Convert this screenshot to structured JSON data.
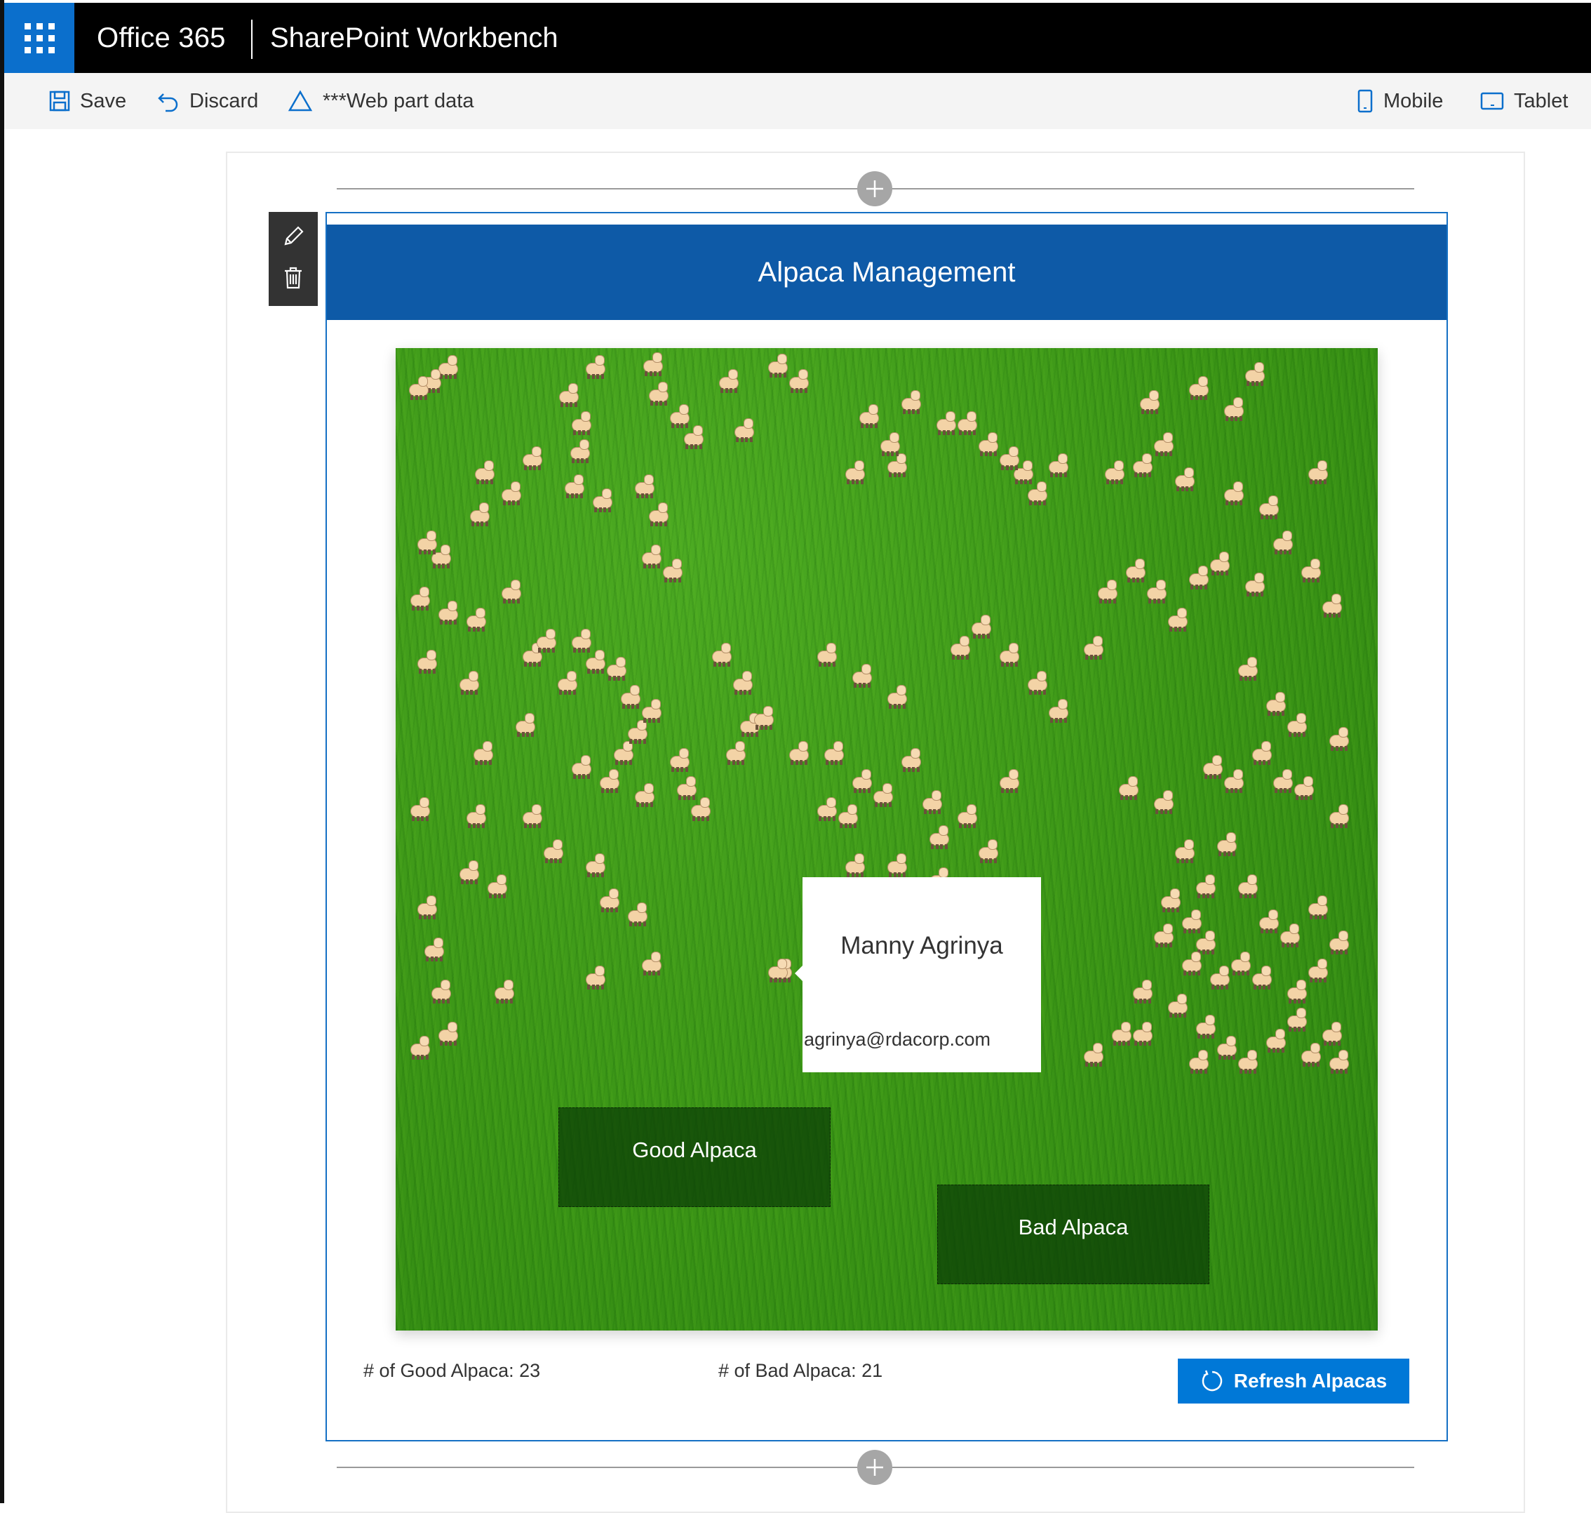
{
  "suite_bar": {
    "brand": "Office 365",
    "app_title": "SharePoint Workbench",
    "accent_color": "#0b6fcc"
  },
  "command_bar": {
    "save_label": "Save",
    "discard_label": "Discard",
    "webpart_data_label": "***Web part data",
    "mobile_label": "Mobile",
    "tablet_label": "Tablet"
  },
  "webpart": {
    "header_title": "Alpaca Management",
    "header_color": "#0e5aa7",
    "callout": {
      "name": "Manny Agrinya",
      "email": "agrinya@rdacorp.com"
    },
    "good_zone_label": "Good Alpaca",
    "bad_zone_label": "Bad Alpaca",
    "good_count_text": "# of Good Alpaca: 23",
    "bad_count_text": "# of Bad Alpaca: 21",
    "refresh_button_label": "Refresh Alpacas",
    "button_color": "#0078d7"
  }
}
